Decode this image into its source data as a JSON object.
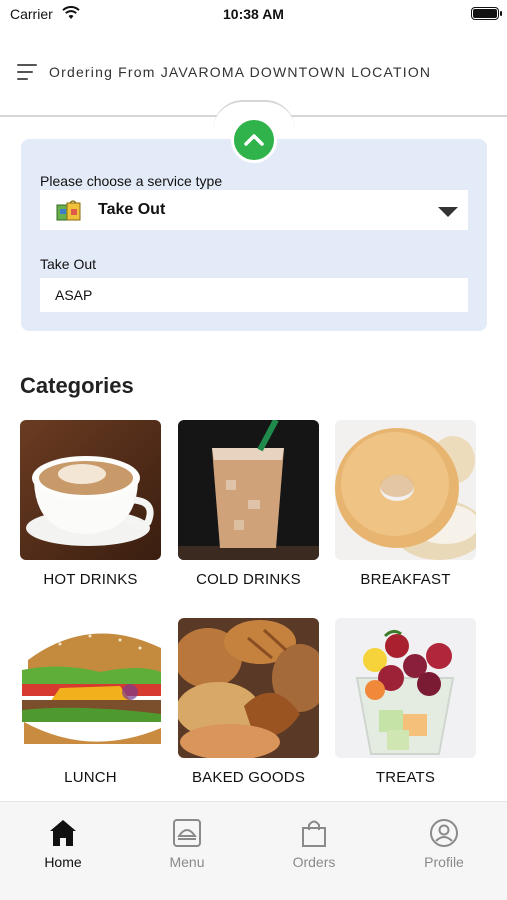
{
  "status_bar": {
    "carrier": "Carrier",
    "time": "10:38 AM"
  },
  "header": {
    "title": "Ordering From JAVAROMA DOWNTOWN LOCATION"
  },
  "service": {
    "prompt": "Please choose a service type",
    "selected": "Take Out",
    "time_label": "Take Out",
    "time_value": "ASAP"
  },
  "categories": {
    "title": "Categories",
    "items": [
      {
        "label": "HOT DRINKS"
      },
      {
        "label": "COLD DRINKS"
      },
      {
        "label": "BREAKFAST"
      },
      {
        "label": "LUNCH"
      },
      {
        "label": "BAKED GOODS"
      },
      {
        "label": "TREATS"
      }
    ]
  },
  "tabbar": {
    "items": [
      {
        "label": "Home",
        "active": true
      },
      {
        "label": "Menu",
        "active": false
      },
      {
        "label": "Orders",
        "active": false
      },
      {
        "label": "Profile",
        "active": false
      }
    ]
  },
  "colors": {
    "accent_green": "#2fb34a",
    "panel_bg": "#e4ebf8"
  }
}
